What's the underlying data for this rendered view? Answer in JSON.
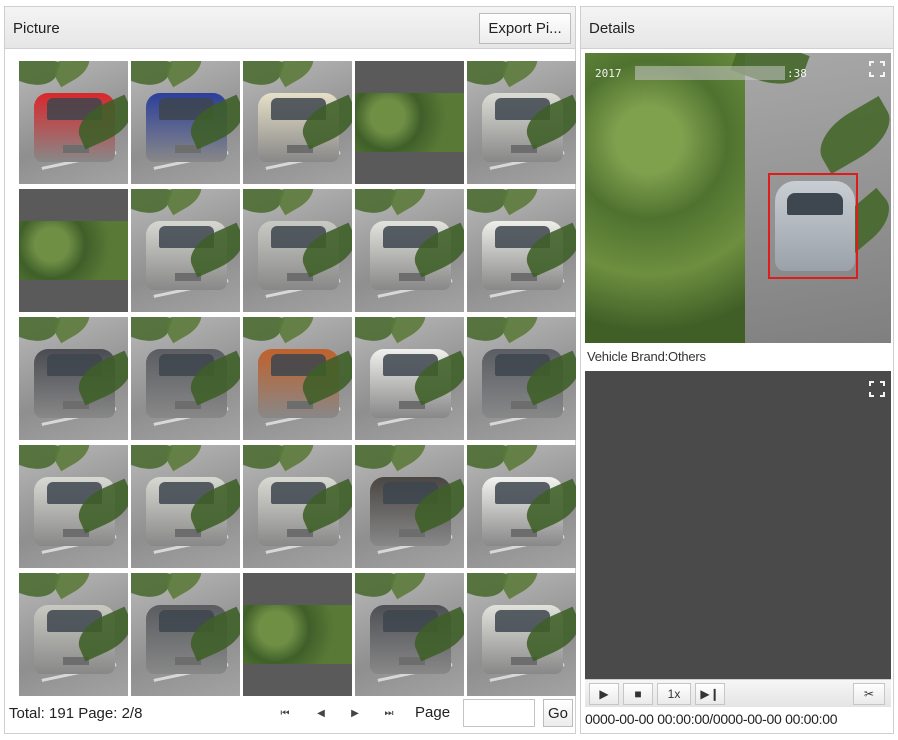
{
  "picture_panel": {
    "title": "Picture",
    "export_label": "Export Pi..."
  },
  "thumbnails": [
    {
      "car_color": "#d8282c"
    },
    {
      "car_color": "#2c3f9a"
    },
    {
      "car_color": "#e6e0c8"
    },
    {
      "car_color": "none"
    },
    {
      "car_color": "#dcdcd6"
    },
    {
      "car_color": "none"
    },
    {
      "car_color": "#d7d7d2"
    },
    {
      "car_color": "#c9c9c4"
    },
    {
      "car_color": "#e3e3de"
    },
    {
      "car_color": "#eeeeea"
    },
    {
      "car_color": "#4a4c52"
    },
    {
      "car_color": "#5b5d62"
    },
    {
      "car_color": "#c0612c"
    },
    {
      "car_color": "#f0f0ee"
    },
    {
      "car_color": "#5a5d63"
    },
    {
      "car_color": "#d9d9d4"
    },
    {
      "car_color": "#d8d8d2"
    },
    {
      "car_color": "#dadad4"
    },
    {
      "car_color": "#4a4643"
    },
    {
      "car_color": "#f3f3f1"
    },
    {
      "car_color": "#c9c9c2"
    },
    {
      "car_color": "#5a5c60"
    },
    {
      "car_color": "none"
    },
    {
      "car_color": "#4e5055"
    },
    {
      "car_color": "#e2e2dd"
    }
  ],
  "footer": {
    "total_text": "Total: 191  Page: 2/8",
    "first_icon": "skip-first-icon",
    "prev_icon": "prev-icon",
    "next_icon": "next-icon",
    "last_icon": "skip-last-icon",
    "page_label": "Page",
    "page_input_value": "",
    "go_label": "Go"
  },
  "details_panel": {
    "title": "Details",
    "timestamp_start": "2017",
    "timestamp_end": ":38",
    "brand_label": "Vehicle Brand:Others",
    "expand_icon": "fullscreen-icon"
  },
  "playback": {
    "play_icon": "play-icon",
    "stop_icon": "stop-icon",
    "speed_label": "1x",
    "step_icon": "step-forward-icon",
    "export_icon": "clip-icon",
    "time_range": "0000-00-00 00:00:00/0000-00-00 00:00:00"
  }
}
